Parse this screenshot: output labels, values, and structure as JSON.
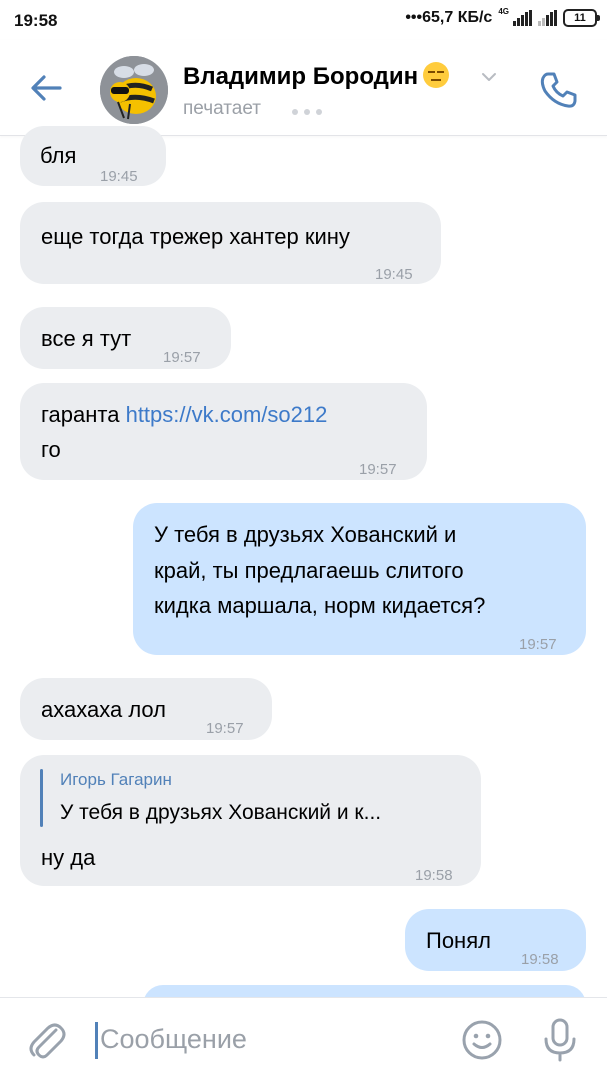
{
  "status_bar": {
    "time": "19:58",
    "network_speed": "65,7 КБ/с",
    "network_type": "4G",
    "battery": "11"
  },
  "header": {
    "contact_name": "Владимир Бородин",
    "status": "печатает"
  },
  "messages": [
    {
      "direction": "in",
      "text": "бля",
      "time": "19:45"
    },
    {
      "direction": "in",
      "text": "еще тогда трежер хантер кину",
      "time": "19:45"
    },
    {
      "direction": "in",
      "text": "все я тут",
      "time": "19:57"
    },
    {
      "direction": "in",
      "text_before": "гаранта ",
      "link": "https://vk.com/so212",
      "text_after": "го",
      "time": "19:57"
    },
    {
      "direction": "out",
      "lines": [
        "У тебя в друзьях Хованский и",
        "край, ты предлагаешь слитого",
        "кидка маршала, норм кидается?"
      ],
      "time": "19:57"
    },
    {
      "direction": "in",
      "text": "ахахаха лол",
      "time": "19:57"
    },
    {
      "direction": "in",
      "reply_name": "Игорь Гагарин",
      "reply_text": "У тебя в друзьях Хованский и к...",
      "text": "ну да",
      "time": "19:58"
    },
    {
      "direction": "out",
      "text": "Понял",
      "time": "19:58"
    }
  ],
  "composer": {
    "placeholder": "Сообщение"
  },
  "colors": {
    "accent": "#5181b8",
    "incoming_bubble": "#ebedf0",
    "outgoing_bubble": "#cce4ff",
    "link": "#3d7ac9"
  }
}
